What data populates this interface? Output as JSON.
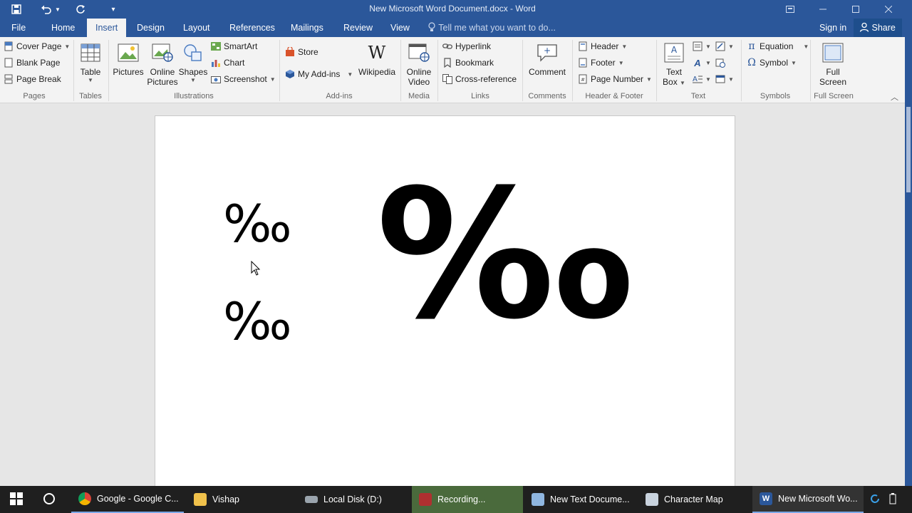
{
  "window": {
    "title": "New Microsoft Word Document.docx - Word"
  },
  "tabs": [
    "File",
    "Home",
    "Insert",
    "Design",
    "Layout",
    "References",
    "Mailings",
    "Review",
    "View"
  ],
  "active_tab": "Insert",
  "tell_me": "Tell me what you want to do...",
  "signin": "Sign in",
  "share": "Share",
  "ribbon": {
    "pages": {
      "label": "Pages",
      "items": [
        "Cover Page",
        "Blank Page",
        "Page Break"
      ]
    },
    "tables": {
      "label": "Tables",
      "table": "Table"
    },
    "illustrations": {
      "label": "Illustrations",
      "pictures": "Pictures",
      "online_pictures": [
        "Online",
        "Pictures"
      ],
      "shapes": "Shapes",
      "smartart": "SmartArt",
      "chart": "Chart",
      "screenshot": "Screenshot"
    },
    "addins": {
      "label": "Add-ins",
      "store": "Store",
      "my_addins": "My Add-ins",
      "wikipedia": "Wikipedia"
    },
    "media": {
      "label": "Media",
      "online_video": [
        "Online",
        "Video"
      ]
    },
    "links": {
      "label": "Links",
      "hyperlink": "Hyperlink",
      "bookmark": "Bookmark",
      "cross_reference": "Cross-reference"
    },
    "comments": {
      "label": "Comments",
      "comment": "Comment"
    },
    "header_footer": {
      "label": "Header & Footer",
      "header": "Header",
      "footer": "Footer",
      "page_number": "Page Number"
    },
    "text": {
      "label": "Text",
      "text_box": [
        "Text",
        "Box"
      ]
    },
    "symbols": {
      "label": "Symbols",
      "equation": "Equation",
      "symbol": "Symbol"
    },
    "full_screen": {
      "label": "Full Screen",
      "button": [
        "Full",
        "Screen"
      ]
    }
  },
  "document": {
    "symbol_small_1": "‰",
    "symbol_small_2": "‰",
    "symbol_large": "‰"
  },
  "taskbar": {
    "items": [
      "Google - Google C...",
      "Vishap",
      "Local Disk (D:)",
      "Recording...",
      "New Text Docume...",
      "Character Map",
      "New Microsoft Wo..."
    ]
  },
  "colors": {
    "word_blue": "#2b579a",
    "ribbon_bg": "#f3f3f3",
    "canvas_bg": "#e6e6e6",
    "taskbar_bg": "#1f1f1f",
    "recording_bg": "#4a6a3c"
  }
}
